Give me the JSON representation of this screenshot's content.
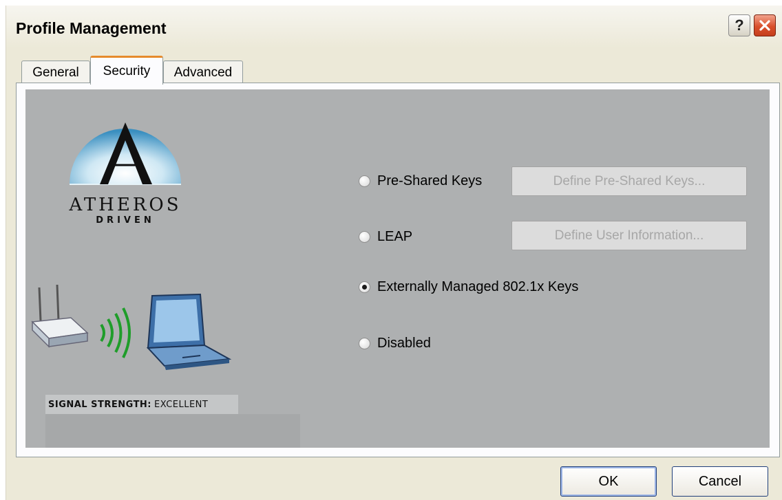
{
  "window": {
    "title": "Profile Management",
    "help_label": "?",
    "close_icon": "close-icon"
  },
  "tabs": [
    {
      "label": "General",
      "active": false
    },
    {
      "label": "Security",
      "active": true
    },
    {
      "label": "Advanced",
      "active": false
    }
  ],
  "branding": {
    "logo_word": "ATHEROS",
    "logo_sub": "DRIVEN",
    "signal_label": "SIGNAL STRENGTH:",
    "signal_value": "EXCELLENT"
  },
  "security": {
    "options": [
      {
        "label": "Pre-Shared Keys",
        "checked": false,
        "button": "Define Pre-Shared Keys...",
        "button_enabled": false
      },
      {
        "label": "LEAP",
        "checked": false,
        "button": "Define User Information...",
        "button_enabled": false
      },
      {
        "label": "Externally Managed 802.1x Keys",
        "checked": true
      },
      {
        "label": "Disabled",
        "checked": false
      }
    ]
  },
  "buttons": {
    "ok": "OK",
    "cancel": "Cancel"
  },
  "colors": {
    "panel_bg": "#aeb0b1",
    "active_tab_accent": "#e68b2c",
    "close_button": "#d9502c"
  }
}
